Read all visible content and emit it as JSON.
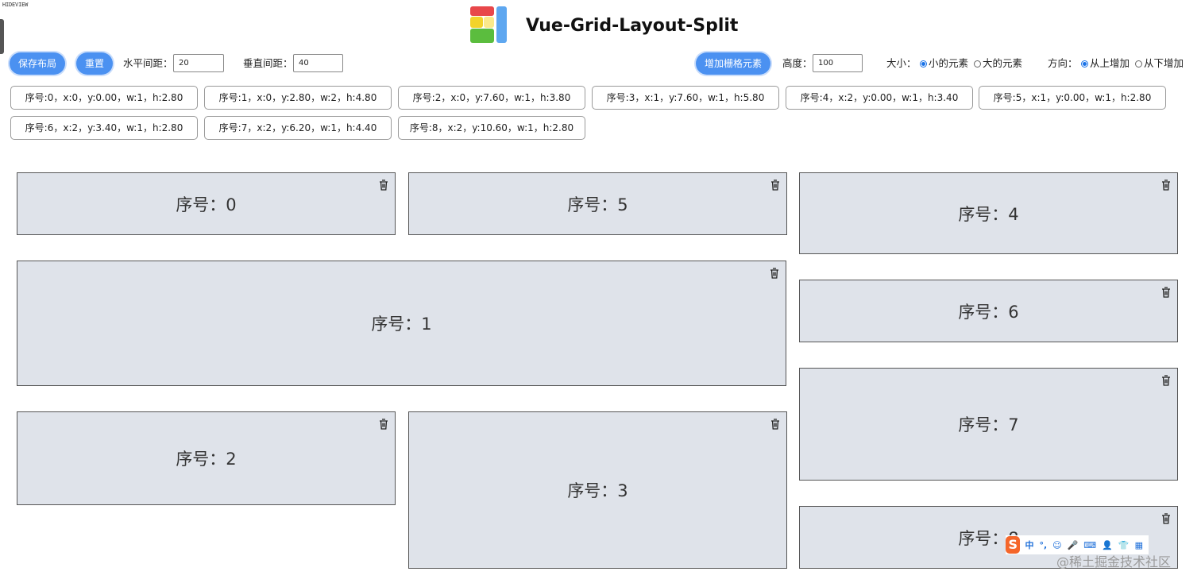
{
  "corner_mark": "HIDEVIEW",
  "app": {
    "title": "Vue-Grid-Layout-Split"
  },
  "toolbar": {
    "save_label": "保存布局",
    "reset_label": "重置",
    "h_gap_label": "水平间距：",
    "h_gap_value": "20",
    "v_gap_label": "垂直间距：",
    "v_gap_value": "40",
    "add_label": "增加栅格元素",
    "height_label": "高度：",
    "height_value": "100",
    "size_label": "大小：",
    "size_options": [
      {
        "label": "小的元素",
        "selected": true
      },
      {
        "label": "大的元素",
        "selected": false
      }
    ],
    "direction_label": "方向：",
    "direction_options": [
      {
        "label": "从上增加",
        "selected": true
      },
      {
        "label": "从下增加",
        "selected": false
      }
    ]
  },
  "layout_list": [
    "序号:0，x:0，y:0.00，w:1，h:2.80",
    "序号:1，x:0，y:2.80，w:2，h:4.80",
    "序号:2，x:0，y:7.60，w:1，h:3.80",
    "序号:3，x:1，y:7.60，w:1，h:5.80",
    "序号:4，x:2，y:0.00，w:1，h:3.40",
    "序号:5，x:1，y:0.00，w:1，h:2.80",
    "序号:6，x:2，y:3.40，w:1，h:2.80",
    "序号:7，x:2，y:6.20，w:1，h:4.40",
    "序号:8，x:2，y:10.60，w:1，h:2.80"
  ],
  "grid_items": [
    {
      "label": "序号：0"
    },
    {
      "label": "序号：5"
    },
    {
      "label": "序号：4"
    },
    {
      "label": "序号：1"
    },
    {
      "label": "序号：6"
    },
    {
      "label": "序号：2"
    },
    {
      "label": "序号：3"
    },
    {
      "label": "序号：7"
    },
    {
      "label": "序号：8"
    }
  ],
  "ime": {
    "logo": "S",
    "items": [
      "中",
      "°,",
      "☺",
      "🎤",
      "⌨",
      "👤",
      "👕",
      "▦"
    ]
  },
  "watermark": "@稀土掘金技术社区",
  "icons": {
    "delete": "trash-icon",
    "logo": "app-logo"
  },
  "colors": {
    "accent": "#4b91f1",
    "item_bg": "#dfe3ea"
  }
}
